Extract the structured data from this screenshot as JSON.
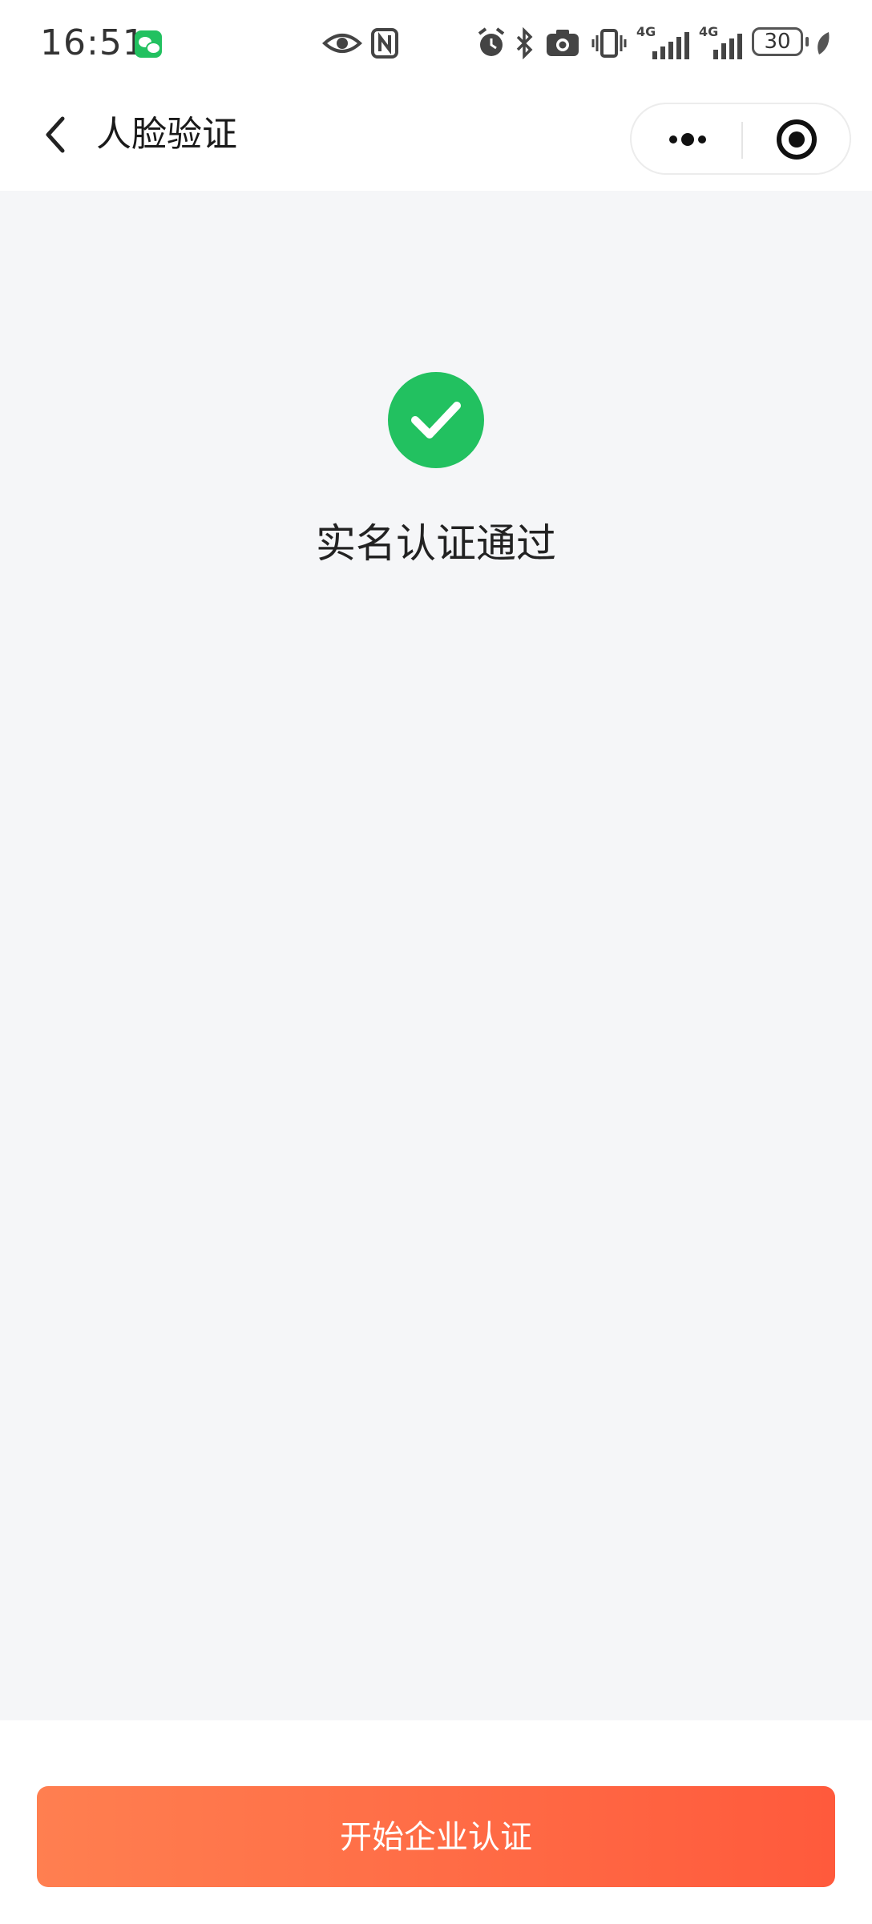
{
  "status_bar": {
    "time": "16:51",
    "battery": "30",
    "network_1": "4G",
    "network_2": "4G"
  },
  "nav": {
    "title": "人脸验证"
  },
  "result": {
    "message": "实名认证通过",
    "icon": "check-circle-icon",
    "color": "#22c160"
  },
  "footer": {
    "button_label": "开始企业认证",
    "button_color_start": "#ff7f50",
    "button_color_end": "#ff5a3c"
  }
}
